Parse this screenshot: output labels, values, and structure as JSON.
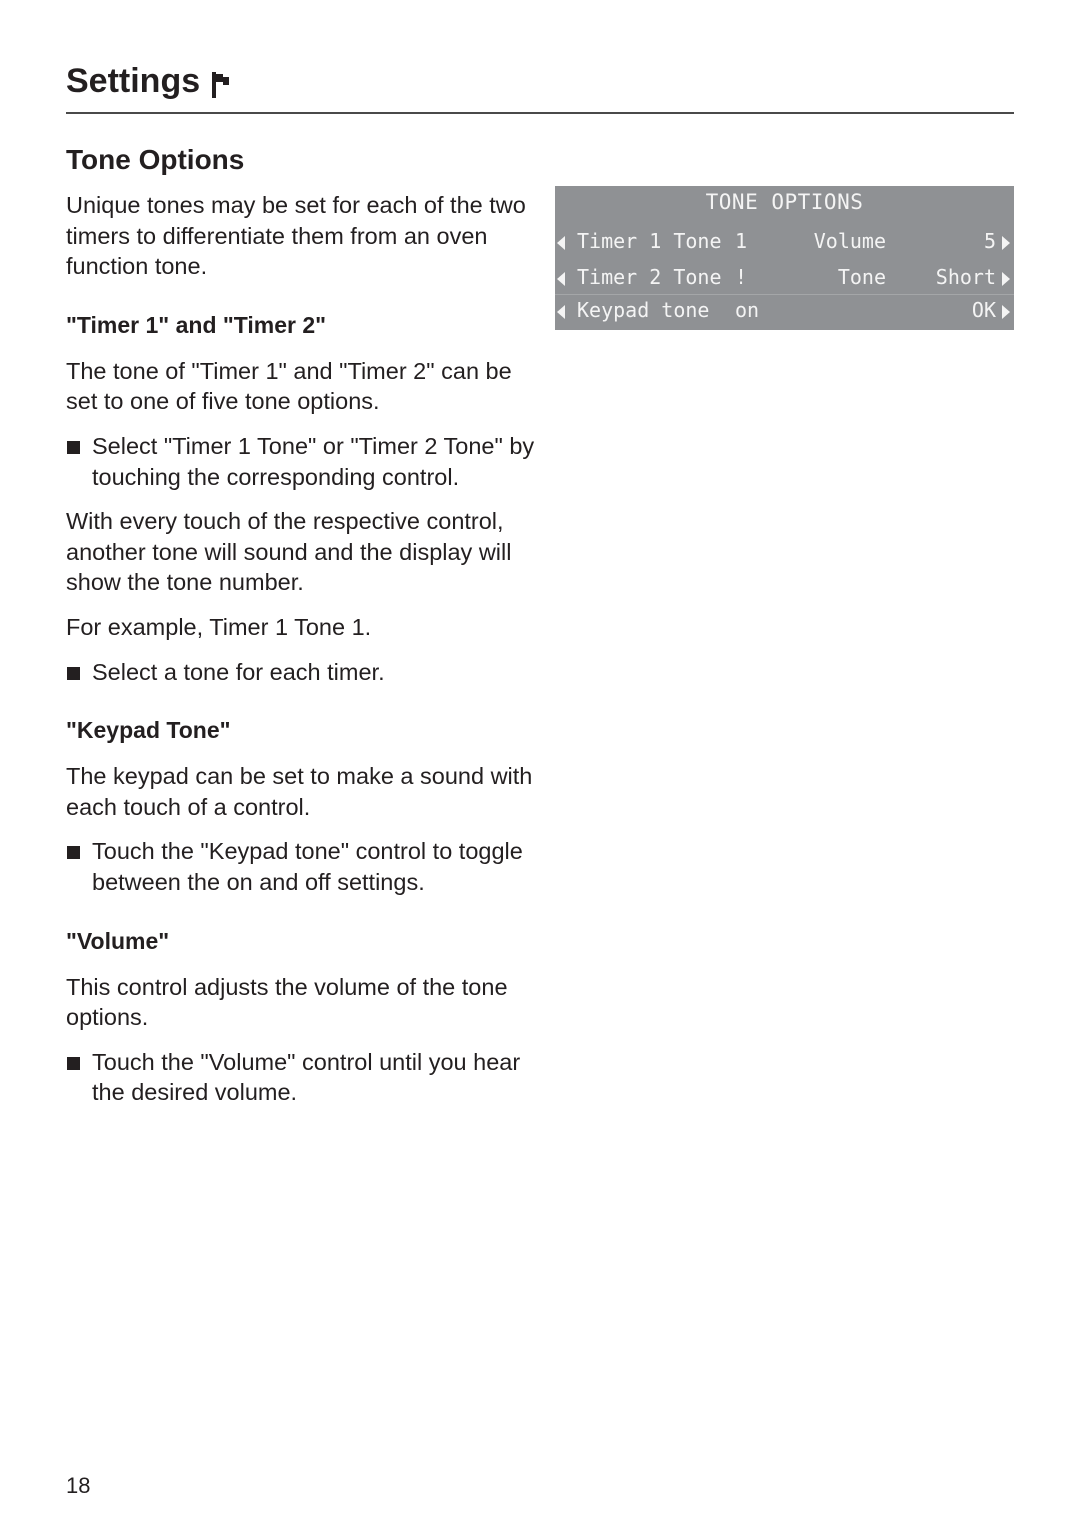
{
  "header": {
    "title": "Settings",
    "icon": "flag-icon"
  },
  "section": {
    "title": "Tone Options",
    "intro": "Unique tones may be set for each of the two timers to differentiate them from an oven function tone."
  },
  "timers": {
    "heading": "\"Timer 1\" and \"Timer 2\"",
    "paragraph": "The tone of \"Timer 1\" and \"Timer 2\" can be set to one of five tone options.",
    "bullet1": "Select \"Timer 1 Tone\" or \"Timer 2 Tone\" by touching the corresponding control.",
    "paragraph2": "With every touch of the respective control, another tone will sound and the display will show the tone number.",
    "example": "For example, Timer 1 Tone 1.",
    "bullet2": "Select a tone for each timer."
  },
  "keypad": {
    "heading": "\"Keypad Tone\"",
    "paragraph": "The keypad can be set to make a sound with each touch of a control.",
    "bullet": "Touch the \"Keypad tone\" control to toggle between the on and off settings."
  },
  "volume": {
    "heading": "\"Volume\"",
    "paragraph": "This control adjusts the volume of the tone options.",
    "bullet": "Touch the \"Volume\" control until you hear the desired volume."
  },
  "display": {
    "title": "TONE OPTIONS",
    "rows": [
      {
        "label": "Timer 1 Tone",
        "value": "1",
        "right_label": "Volume",
        "right_value": "5"
      },
      {
        "label": "Timer 2 Tone",
        "value": "!",
        "right_label": "Tone",
        "right_value": "Short"
      },
      {
        "label": "Keypad tone",
        "value": "on",
        "right_label": "",
        "right_value": "OK"
      }
    ],
    "colors": {
      "background": "#8f9194",
      "text": "#f4f4f4"
    }
  },
  "footer": {
    "page_number": "18"
  }
}
